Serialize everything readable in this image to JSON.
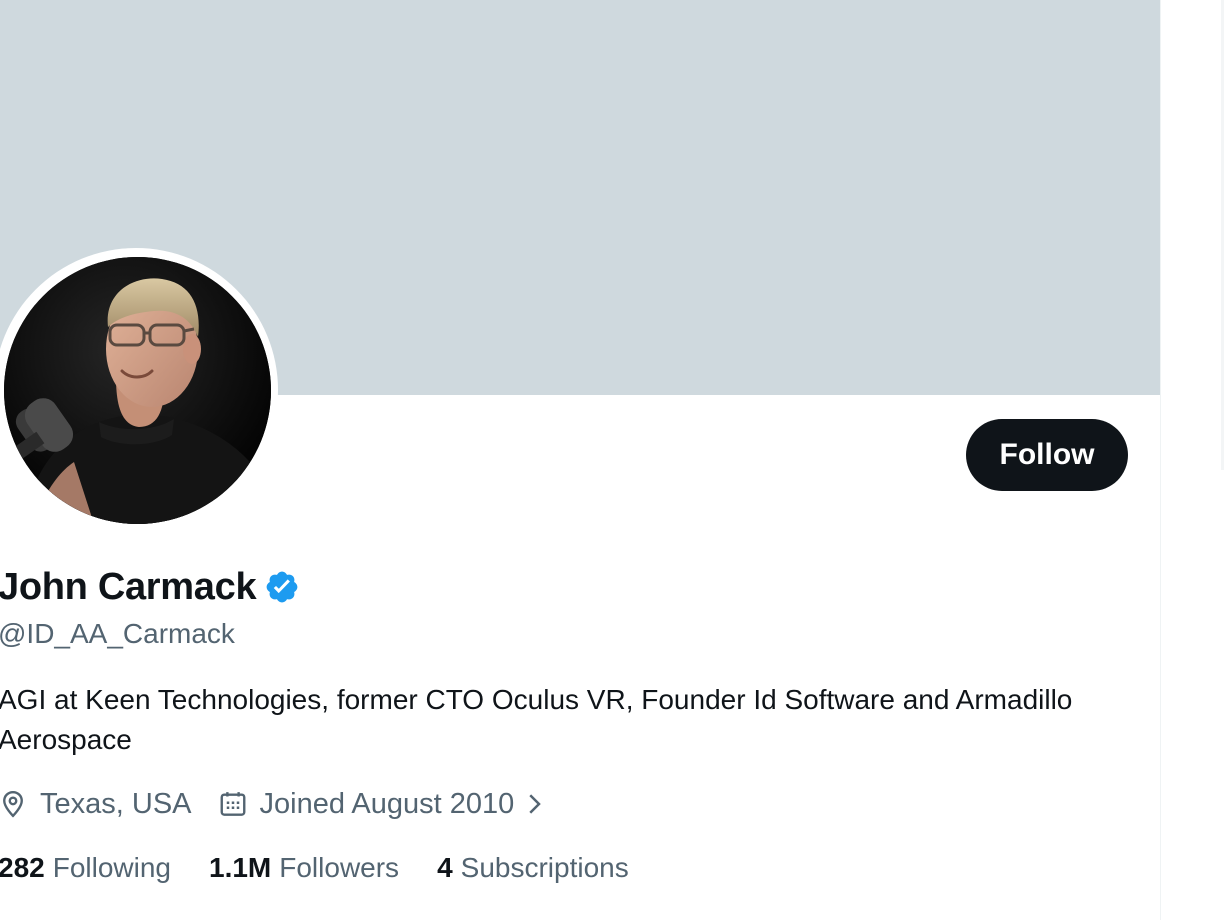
{
  "colors": {
    "banner": "#cfd9de",
    "follow_button_bg": "#0f1419",
    "follow_button_text": "#ffffff",
    "primary_text": "#0f1419",
    "secondary_text": "#536471",
    "verified_badge": "#1d9bf0"
  },
  "profile": {
    "display_name": "John Carmack",
    "verified": true,
    "handle": "@ID_AA_Carmack",
    "bio": "AGI at Keen Technologies, former CTO Oculus VR, Founder Id Software and Armadillo Aerospace",
    "location": "Texas, USA",
    "joined": "Joined August 2010"
  },
  "actions": {
    "follow_label": "Follow"
  },
  "stats": [
    {
      "count": "282",
      "label": "Following"
    },
    {
      "count": "1.1M",
      "label": "Followers"
    },
    {
      "count": "4",
      "label": "Subscriptions"
    }
  ],
  "icons": {
    "location": "location-pin-icon",
    "calendar": "calendar-icon",
    "chevron": "chevron-right-icon",
    "verified": "verified-badge-icon"
  }
}
